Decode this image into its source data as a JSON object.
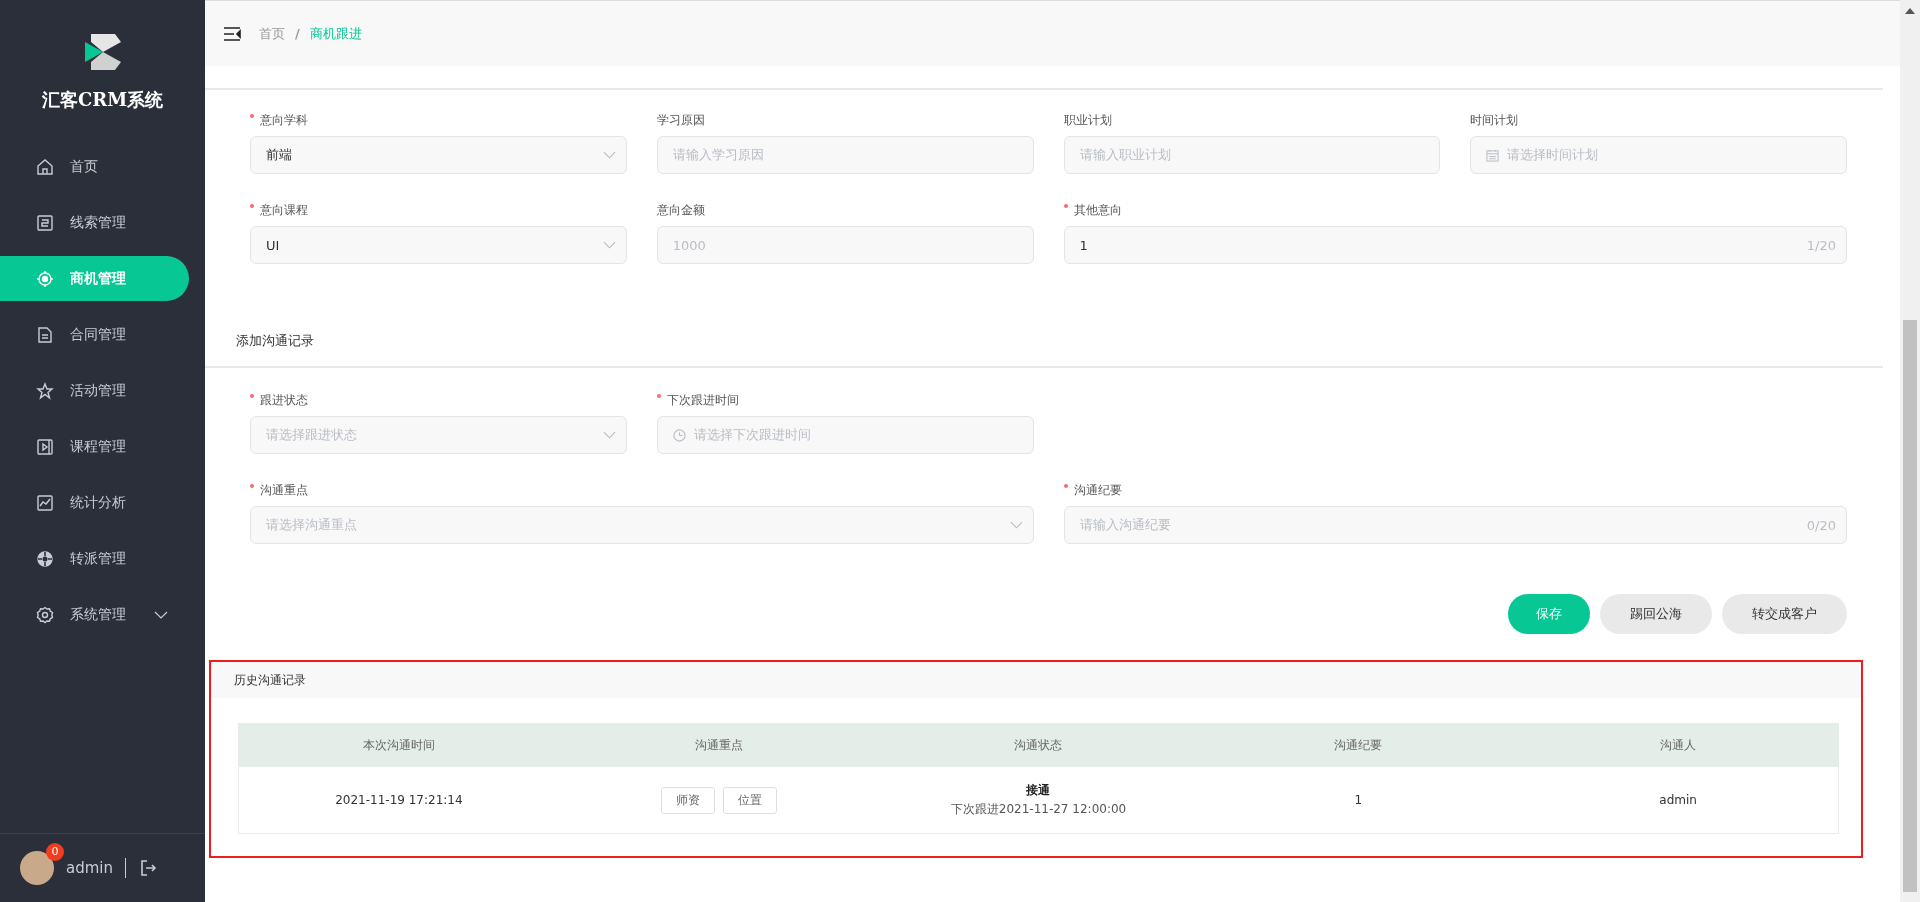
{
  "app": {
    "title": "汇客CRM系统"
  },
  "sidebar": {
    "items": [
      {
        "label": "首页",
        "selected": false,
        "has_submenu": false
      },
      {
        "label": "线索管理",
        "selected": false,
        "has_submenu": false
      },
      {
        "label": "商机管理",
        "selected": true,
        "has_submenu": false
      },
      {
        "label": "合同管理",
        "selected": false,
        "has_submenu": false
      },
      {
        "label": "活动管理",
        "selected": false,
        "has_submenu": false
      },
      {
        "label": "课程管理",
        "selected": false,
        "has_submenu": false
      },
      {
        "label": "统计分析",
        "selected": false,
        "has_submenu": false
      },
      {
        "label": "转派管理",
        "selected": false,
        "has_submenu": false
      },
      {
        "label": "系统管理",
        "selected": false,
        "has_submenu": true
      }
    ]
  },
  "user": {
    "name": "admin",
    "badge": "0"
  },
  "breadcrumb": {
    "separator": "/",
    "items": [
      {
        "label": "首页",
        "current": false
      },
      {
        "label": "商机跟进",
        "current": true
      }
    ]
  },
  "intent_form": {
    "rows": [
      [
        {
          "label": "意向学科",
          "required": true,
          "kind": "select",
          "value": "前端",
          "wide": false
        },
        {
          "label": "学习原因",
          "required": false,
          "kind": "text",
          "placeholder": "请输入学习原因",
          "wide": false
        },
        {
          "label": "职业计划",
          "required": false,
          "kind": "text",
          "placeholder": "请输入职业计划",
          "wide": false
        },
        {
          "label": "时间计划",
          "required": false,
          "kind": "date",
          "placeholder": "请选择时间计划",
          "wide": false
        }
      ],
      [
        {
          "label": "意向课程",
          "required": true,
          "kind": "select",
          "value": "UI",
          "wide": false
        },
        {
          "label": "意向金额",
          "required": false,
          "kind": "text",
          "placeholder": "1000",
          "wide": false
        },
        {
          "label": "其他意向",
          "required": true,
          "kind": "text",
          "value": "1",
          "counter": "1/20",
          "wide": true
        }
      ]
    ]
  },
  "communication_form": {
    "title": "添加沟通记录",
    "rows": [
      [
        {
          "label": "跟进状态",
          "required": true,
          "kind": "select",
          "placeholder": "请选择跟进状态",
          "wide": false
        },
        {
          "label": "下次跟进时间",
          "required": true,
          "kind": "time",
          "placeholder": "请选择下次跟进时间",
          "wide": false
        }
      ],
      [
        {
          "label": "沟通重点",
          "required": true,
          "kind": "select",
          "placeholder": "请选择沟通重点",
          "wide": true
        },
        {
          "label": "沟通纪要",
          "required": true,
          "kind": "text",
          "placeholder": "请输入沟通纪要",
          "counter": "0/20",
          "wide": true
        }
      ]
    ]
  },
  "buttons": [
    {
      "label": "保存",
      "kind": "primary"
    },
    {
      "label": "踢回公海",
      "kind": "secondary"
    },
    {
      "label": "转交成客户",
      "kind": "secondary"
    }
  ],
  "history": {
    "title": "历史沟通记录",
    "columns": [
      "本次沟通时间",
      "沟通重点",
      "沟通状态",
      "沟通纪要",
      "沟通人"
    ],
    "rows": [
      {
        "time": "2021-11-19 17:21:14",
        "tags": [
          "师资",
          "位置"
        ],
        "status": "接通",
        "next": "下次跟进2021-11-27 12:00:00",
        "summary": "1",
        "person": "admin"
      }
    ]
  }
}
